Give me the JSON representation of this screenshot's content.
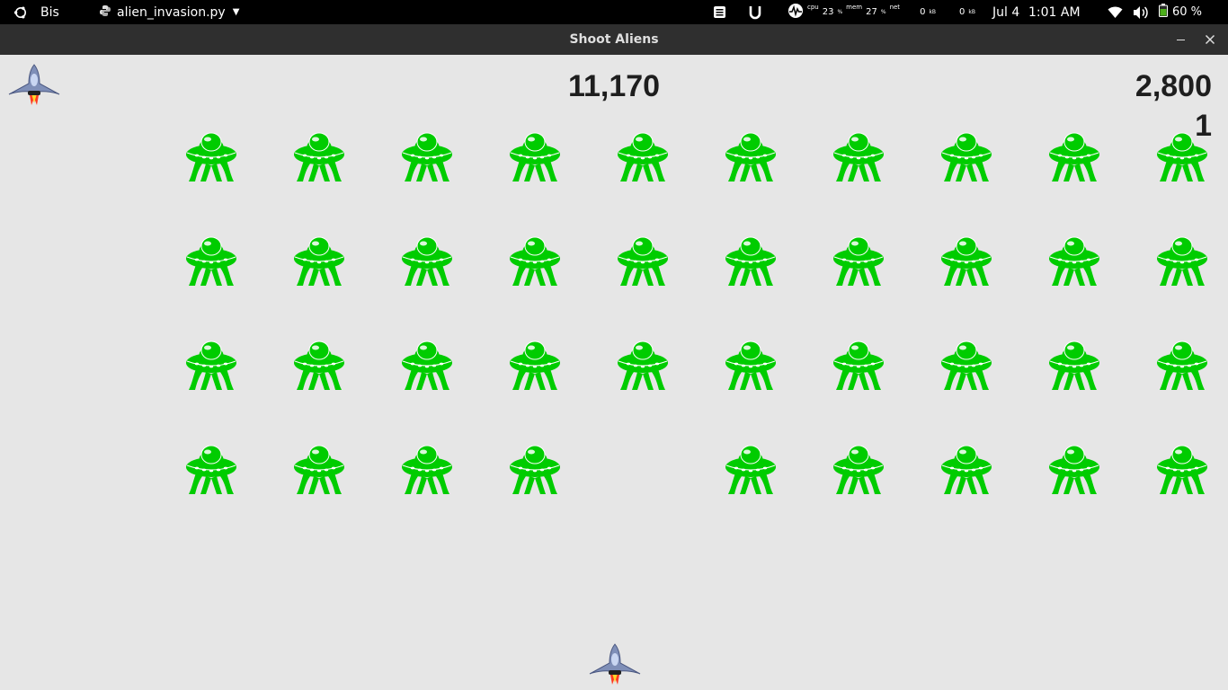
{
  "topbar": {
    "app_name": "Bis",
    "file_name": "alien_invasion.py",
    "cpu_label": "cpu",
    "cpu_value": "23",
    "mem_label": "mem",
    "mem_value": "27",
    "net_label": "net",
    "net_down": "0",
    "net_up": "0",
    "date": "Jul 4",
    "time": "1:01 AM",
    "battery": "60 %"
  },
  "window": {
    "title": "Shoot Aliens"
  },
  "game": {
    "score": "11,170",
    "high_score": "2,800",
    "level": "1",
    "ships_left": 1,
    "alien_color": "#00cc00",
    "alien_rows": [
      [
        1,
        1,
        1,
        1,
        1,
        1,
        1,
        1,
        1,
        1
      ],
      [
        1,
        1,
        1,
        1,
        1,
        1,
        1,
        1,
        1,
        1
      ],
      [
        1,
        1,
        1,
        1,
        1,
        1,
        1,
        1,
        1,
        1
      ],
      [
        1,
        1,
        1,
        1,
        0,
        1,
        1,
        1,
        1,
        1
      ]
    ]
  }
}
